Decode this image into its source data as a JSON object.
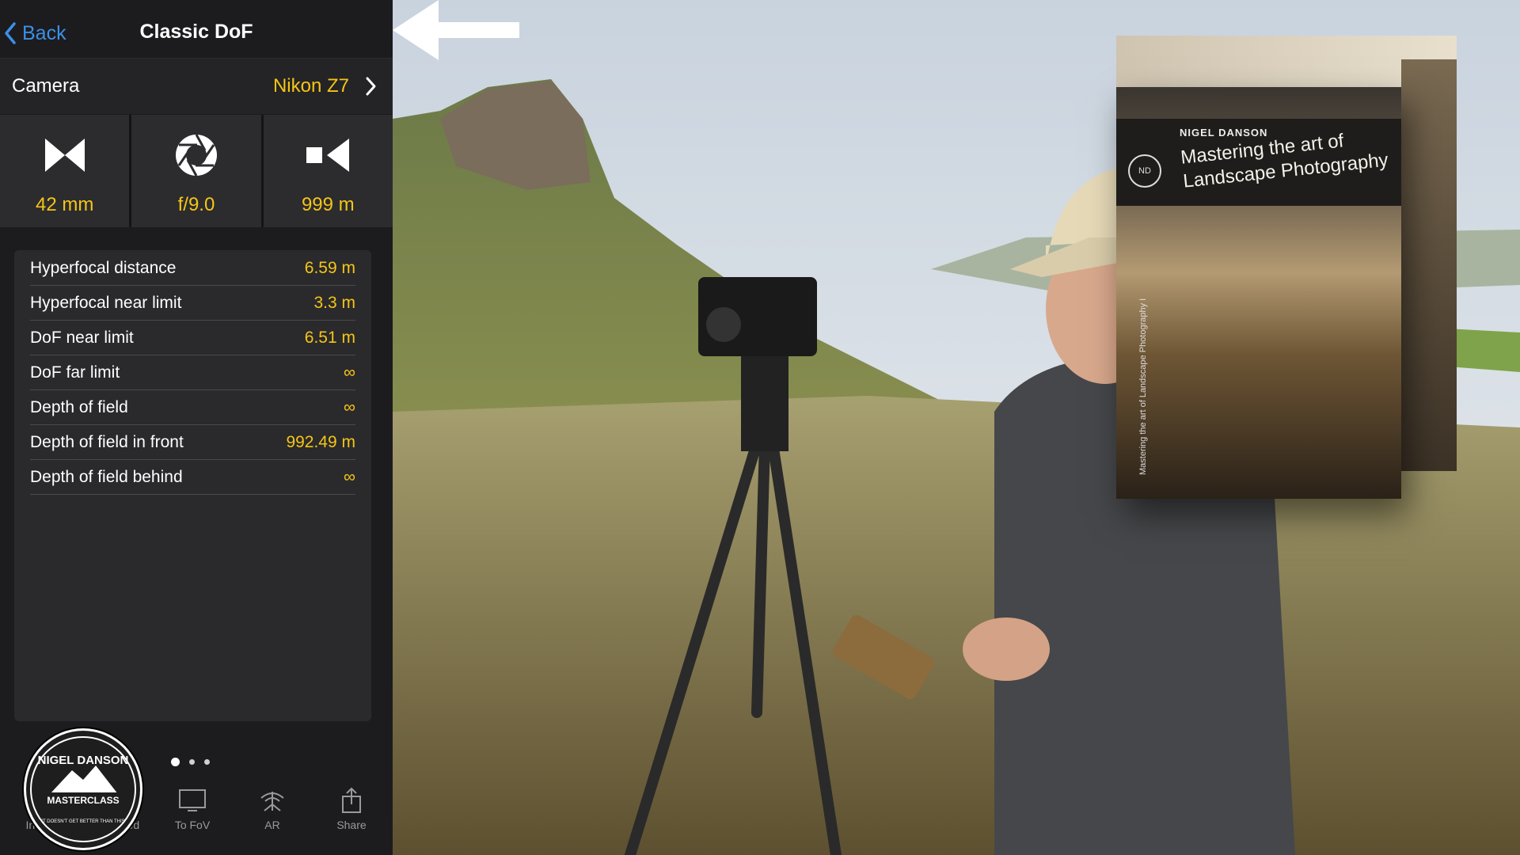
{
  "nav": {
    "back_label": "Back",
    "title": "Classic DoF"
  },
  "camera": {
    "label": "Camera",
    "value": "Nikon Z7"
  },
  "tiles": [
    {
      "icon": "focal-length-icon",
      "value": "42 mm"
    },
    {
      "icon": "aperture-icon",
      "value": "f/9.0"
    },
    {
      "icon": "focus-distance-icon",
      "value": "999 m"
    }
  ],
  "results": [
    {
      "label": "Hyperfocal distance",
      "value": "6.59 m"
    },
    {
      "label": "Hyperfocal near limit",
      "value": "3.3 m"
    },
    {
      "label": "DoF near limit",
      "value": "6.51 m"
    },
    {
      "label": "DoF far limit",
      "value": "∞"
    },
    {
      "label": "Depth of field",
      "value": "∞"
    },
    {
      "label": "Depth of field in front",
      "value": "992.49 m"
    },
    {
      "label": "Depth of field behind",
      "value": "∞"
    }
  ],
  "toolbar": {
    "invert": "Invert",
    "advanced": "Advanced",
    "to_fov": "To FoV",
    "ar": "AR",
    "share": "Share"
  },
  "page_indicator": {
    "count": 3,
    "active": 1
  },
  "overlay_logo": {
    "line1": "NIGEL DANSON",
    "line2": "MASTERCLASS",
    "line3": "IT DOESN'T GET BETTER THAN THIS"
  },
  "product_box": {
    "brand": "NIGEL DANSON",
    "brand_mark": "ND",
    "title": "Mastering the art of Landscape Photography",
    "spine": "Mastering the art of Landscape Photography I"
  },
  "colors": {
    "accent_yellow": "#f5c517",
    "link_blue": "#3d8fe8"
  }
}
